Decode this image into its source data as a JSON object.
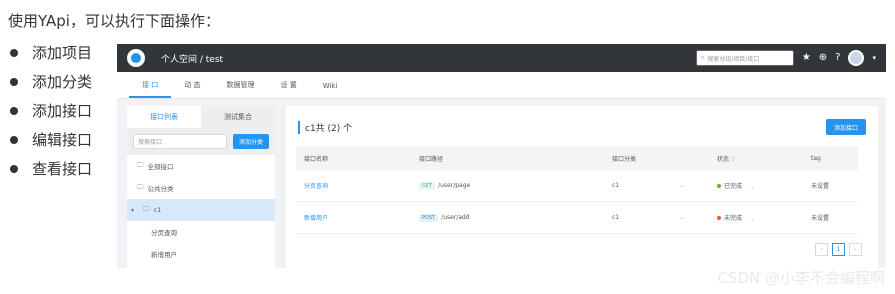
{
  "heading": "使用YApi，可以执行下面操作：",
  "bullets": [
    "添加项目",
    "添加分类",
    "添加接口",
    "编辑接口",
    "查看接口"
  ],
  "app": {
    "breadcrumb": "个人空间 / test",
    "search_placeholder": "搜索分组/项目/接口",
    "tabs": [
      "接 口",
      "动 态",
      "数据管理",
      "设 置",
      "Wiki"
    ],
    "sidebar": {
      "tabs": [
        "接口列表",
        "测试集合"
      ],
      "search_placeholder": "搜索接口",
      "add_category": "添加分类",
      "items": [
        "全部接口",
        "公共分类",
        "c1",
        "分页查询",
        "新增用户"
      ]
    },
    "main": {
      "title": "c1共 (2) 个",
      "add_button": "添加接口",
      "columns": [
        "接口名称",
        "接口路径",
        "接口分类",
        "状态",
        "tag"
      ],
      "rows": [
        {
          "name": "分页查询",
          "method": "GET",
          "path": "/user/page",
          "category": "c1",
          "status": "已完成",
          "tag": "未设置"
        },
        {
          "name": "新增用户",
          "method": "POST",
          "path": "/user/add",
          "category": "c1",
          "status": "未完成",
          "tag": "未设置"
        }
      ],
      "page": "1"
    }
  },
  "watermark": "CSDN @小李不会编程啊",
  "colors": {
    "accent": "#2395f1",
    "done": "#52c41a",
    "undone": "#fa541c",
    "topbar": "#32363a"
  }
}
